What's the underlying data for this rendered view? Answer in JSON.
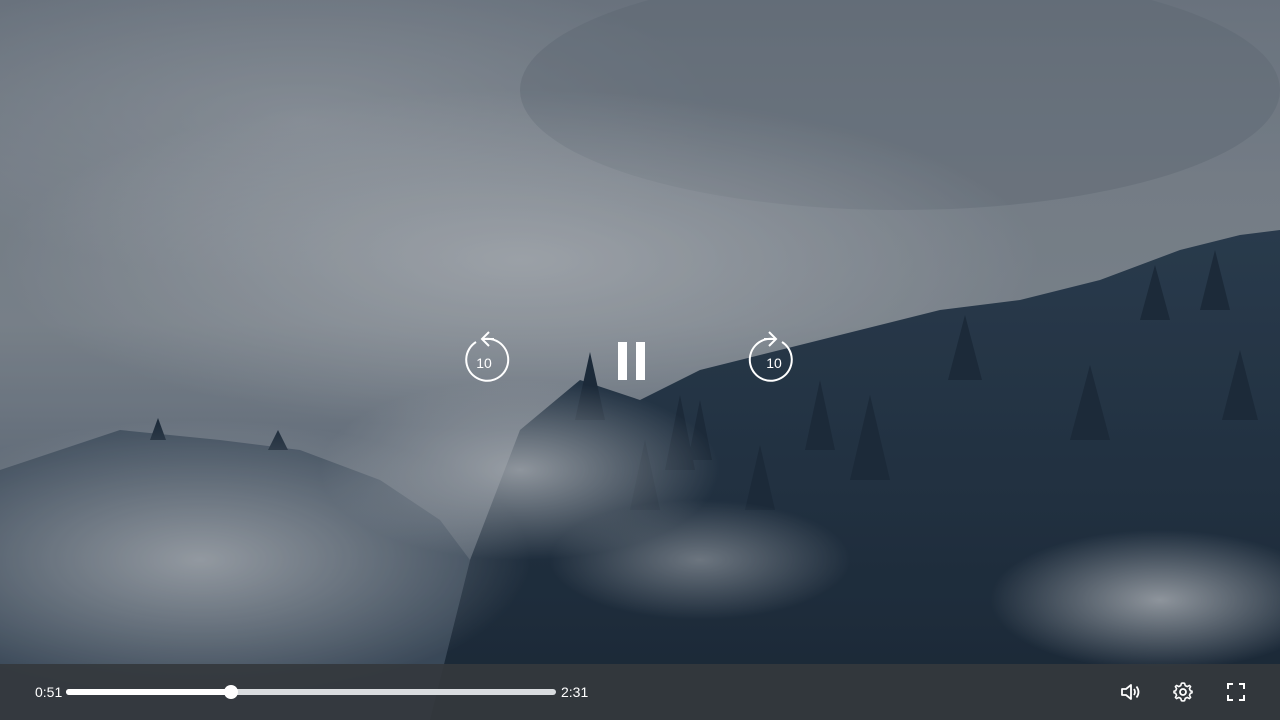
{
  "player": {
    "current_time": "0:51",
    "duration": "2:31",
    "progress": 0.3377,
    "skip_back_seconds": "10",
    "skip_forward_seconds": "10",
    "state_icon": "pause-icon"
  },
  "controls": {
    "volume_icon": "volume-icon",
    "settings_icon": "gear-icon",
    "fullscreen_icon": "fullscreen-icon"
  },
  "colors": {
    "control_bar": "#34383d",
    "track": "#d9dcdf",
    "accent": "#ffffff"
  }
}
